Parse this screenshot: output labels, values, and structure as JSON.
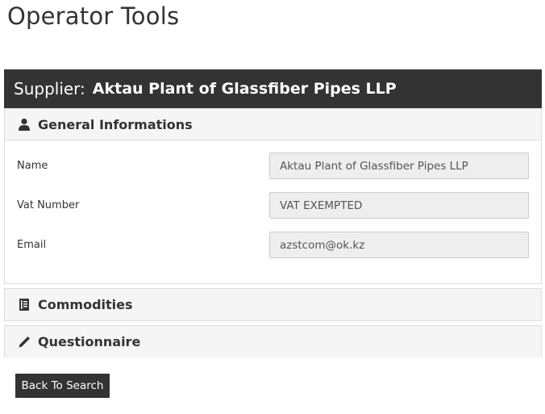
{
  "page": {
    "title": "Operator Tools"
  },
  "supplier": {
    "label": "Supplier:",
    "name": "Aktau Plant of Glassfiber Pipes LLP"
  },
  "panels": {
    "general": {
      "title": "General Informations",
      "icon": "user-icon",
      "fields": [
        {
          "label": "Name",
          "value": "Aktau Plant of Glassfiber Pipes LLP"
        },
        {
          "label": "Vat Number",
          "value": "VAT EXEMPTED"
        },
        {
          "label": "Email",
          "value": "azstcom@ok.kz"
        }
      ]
    },
    "commodities": {
      "title": "Commodities",
      "icon": "book-icon"
    },
    "questionnaire": {
      "title": "Questionnaire",
      "icon": "pencil-icon"
    }
  },
  "actions": {
    "back_label": "Back To Search"
  },
  "colors": {
    "header_bg": "#333333",
    "panel_heading_bg": "#f5f5f5",
    "field_bg": "#eeeeee"
  }
}
